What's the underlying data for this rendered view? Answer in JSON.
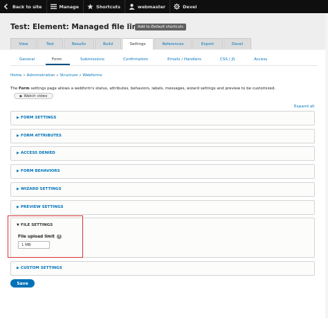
{
  "toolbar": {
    "items": [
      {
        "label": "Back to site",
        "icon": "back-arrow-icon"
      },
      {
        "label": "Manage",
        "icon": "menu-icon"
      },
      {
        "label": "Shortcuts",
        "icon": "star-icon"
      },
      {
        "label": "webmaster",
        "icon": "user-icon"
      },
      {
        "label": "Devel",
        "icon": "gear-icon"
      }
    ]
  },
  "header": {
    "title": "Test: Element: Managed file limit",
    "shortcut_prefix": "Add to ",
    "shortcut_italic": "Default",
    "shortcut_suffix": " shortcuts"
  },
  "primary_tabs": [
    "View",
    "Test",
    "Results",
    "Build",
    "Settings",
    "References",
    "Export",
    "Devel"
  ],
  "primary_active": "Settings",
  "secondary_tabs": [
    "General",
    "Form",
    "Submissions",
    "Confirmation",
    "Emails / Handlers",
    "CSS / JS",
    "Access"
  ],
  "secondary_active": "Form",
  "breadcrumb": {
    "items": [
      "Home",
      "Administration",
      "Structure",
      "Webforms"
    ],
    "separator": "»"
  },
  "description": {
    "prefix": "The ",
    "bold": "Form",
    "suffix": " settings page allows a webform's status, attributes, behaviors, labels, messages, wizard settings and preview to be customized."
  },
  "watch_video": "Watch video",
  "expand_all": "Expand all",
  "sections": [
    {
      "title": "FORM SETTINGS",
      "open": false
    },
    {
      "title": "FORM ATTRIBUTES",
      "open": false
    },
    {
      "title": "ACCESS DENIED",
      "open": false
    },
    {
      "title": "FORM BEHAVIORS",
      "open": false
    },
    {
      "title": "WIZARD SETTINGS",
      "open": false
    },
    {
      "title": "PREVIEW SETTINGS",
      "open": false
    },
    {
      "title": "FILE SETTINGS",
      "open": true
    },
    {
      "title": "CUSTOM SETTINGS",
      "open": false
    }
  ],
  "file_settings": {
    "label": "File upload limit",
    "help": "?",
    "value": "1 MB"
  },
  "save_label": "Save",
  "colors": {
    "link": "#0074bd",
    "button": "#0071b8",
    "highlight": "#d53032"
  }
}
